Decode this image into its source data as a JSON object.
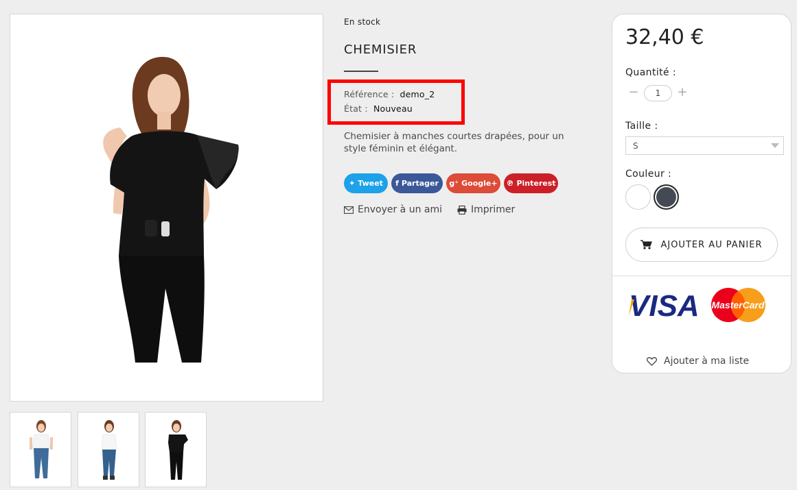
{
  "product": {
    "availability": "En stock",
    "title": "CHEMISIER",
    "reference_label": "Référence :",
    "reference_value": "demo_2",
    "condition_label": "État :",
    "condition_value": "Nouveau",
    "description": "Chemisier à manches courtes drapées, pour un style féminin et élégant."
  },
  "share": {
    "tweet": "Tweet",
    "facebook": "Partager",
    "google": "Google+",
    "pinterest": "Pinterest"
  },
  "actions": {
    "send_friend": "Envoyer à un ami",
    "print": "Imprimer"
  },
  "buy": {
    "price": "32,40 €",
    "quantity_label": "Quantité :",
    "quantity_value": "1",
    "size_label": "Taille :",
    "size_value": "S",
    "color_label": "Couleur :",
    "colors": [
      "#ffffff",
      "#434a54"
    ],
    "add_to_cart": "AJOUTER AU PANIER",
    "wishlist": "Ajouter à ma liste",
    "payment_visa": "VISA",
    "payment_mastercard": "MasterCard"
  },
  "colors": {
    "twitter": "#1da1e8",
    "facebook": "#3b5998",
    "google": "#dd4b39",
    "pinterest": "#cb2027",
    "highlight": "#ff0000"
  },
  "icons": [
    "twitter-icon",
    "facebook-icon",
    "google-plus-icon",
    "pinterest-icon",
    "envelope-icon",
    "printer-icon",
    "cart-icon",
    "heart-icon"
  ]
}
